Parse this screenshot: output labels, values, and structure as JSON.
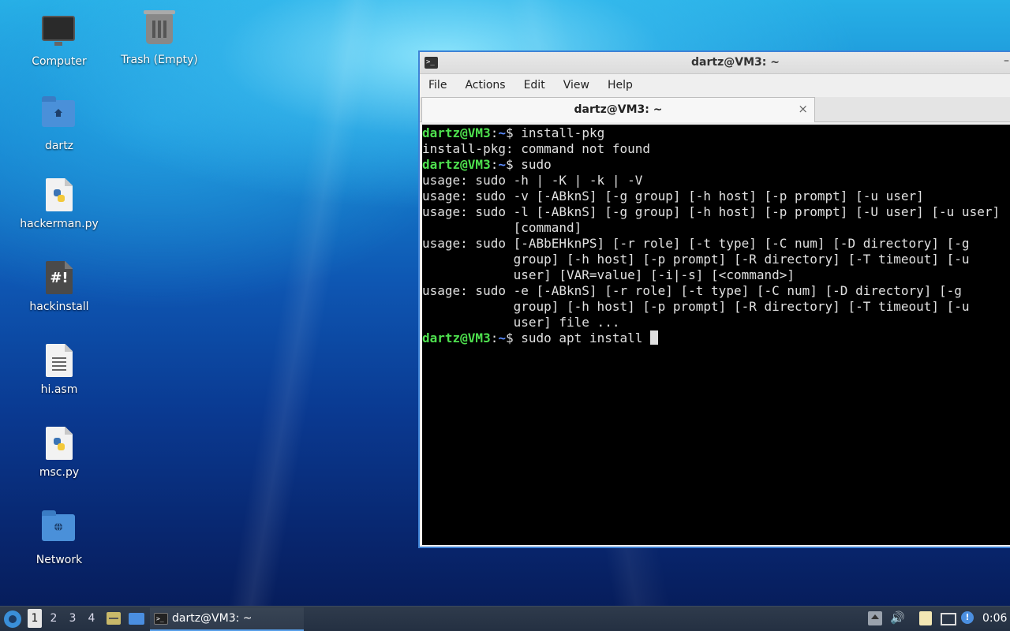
{
  "desktop": {
    "icons": [
      {
        "label": "Computer",
        "icon": "computer-icon"
      },
      {
        "label": "Trash (Empty)",
        "icon": "trash-icon"
      },
      {
        "label": "dartz",
        "icon": "home-folder-icon"
      },
      {
        "label": "hackerman.py",
        "icon": "python-file-icon"
      },
      {
        "label": "hackinstall",
        "icon": "script-file-icon"
      },
      {
        "label": "hi.asm",
        "icon": "text-file-icon"
      },
      {
        "label": "msc.py",
        "icon": "python-file-icon"
      },
      {
        "label": "Network",
        "icon": "network-folder-icon"
      }
    ],
    "script_symbol": "#!"
  },
  "window": {
    "title": "dartz@VM3: ~",
    "menu": [
      "File",
      "Actions",
      "Edit",
      "View",
      "Help"
    ],
    "tab": {
      "label": "dartz@VM3: ~",
      "close": "×"
    },
    "accent": "#3d82d6"
  },
  "terminal": {
    "prompt_user": "dartz@VM3",
    "prompt_sep": ":",
    "prompt_path": "~",
    "prompt_end": "$ ",
    "lines": [
      {
        "prompt": true,
        "text": "install-pkg"
      },
      {
        "prompt": false,
        "text": "install-pkg: command not found"
      },
      {
        "prompt": true,
        "text": "sudo"
      },
      {
        "prompt": false,
        "text": "usage: sudo -h | -K | -k | -V"
      },
      {
        "prompt": false,
        "text": "usage: sudo -v [-ABknS] [-g group] [-h host] [-p prompt] [-u user]"
      },
      {
        "prompt": false,
        "text": "usage: sudo -l [-ABknS] [-g group] [-h host] [-p prompt] [-U user] [-u user]"
      },
      {
        "prompt": false,
        "text": "            [command]"
      },
      {
        "prompt": false,
        "text": "usage: sudo [-ABbEHknPS] [-r role] [-t type] [-C num] [-D directory] [-g"
      },
      {
        "prompt": false,
        "text": "            group] [-h host] [-p prompt] [-R directory] [-T timeout] [-u"
      },
      {
        "prompt": false,
        "text": "            user] [VAR=value] [-i|-s] [<command>]"
      },
      {
        "prompt": false,
        "text": "usage: sudo -e [-ABknS] [-r role] [-t type] [-C num] [-D directory] [-g"
      },
      {
        "prompt": false,
        "text": "            group] [-h host] [-p prompt] [-R directory] [-T timeout] [-u"
      },
      {
        "prompt": false,
        "text": "            user] file ..."
      },
      {
        "prompt": true,
        "text": "sudo apt install ",
        "cursor": true
      }
    ],
    "colors": {
      "user": "#4ee04e",
      "path": "#5c8cff",
      "text": "#e0e0e0",
      "bg": "#000000"
    }
  },
  "taskbar": {
    "workspaces": [
      "1",
      "2",
      "3",
      "4"
    ],
    "active_workspace": "1",
    "task_label": "dartz@VM3: ~",
    "clock": "0:06",
    "volume_glyph": "🔊",
    "notification_glyph": "!"
  }
}
